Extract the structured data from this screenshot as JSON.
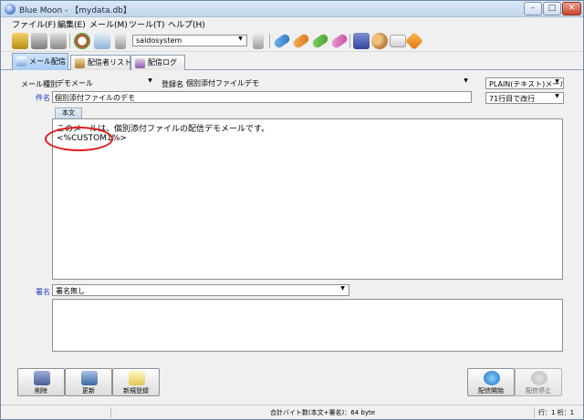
{
  "window": {
    "title": "Blue Moon  - 【mydata.db】",
    "min_label": "–",
    "max_label": "□",
    "close_label": "✕"
  },
  "menu": [
    {
      "label": "ファイル(F)"
    },
    {
      "label": "編集(E)"
    },
    {
      "label": "メール(M)"
    },
    {
      "label": "ツール(T)"
    },
    {
      "label": "ヘルプ(H)"
    }
  ],
  "toolbar": {
    "db_combo": "saldosystem",
    "icons": [
      "db-add-icon",
      "db-open-icon",
      "db-icon",
      "refresh-icon",
      "search-icon",
      "clip-icon",
      "connect-icon",
      "pill-blue-icon",
      "pill-orange-icon",
      "pill-green-icon",
      "pill-pink-icon",
      "book-icon",
      "users-icon",
      "mail-icon",
      "tool-icon"
    ]
  },
  "tabs": [
    {
      "label": "メール配信",
      "active": true
    },
    {
      "label": "配信者リスト",
      "active": false
    },
    {
      "label": "配信ログ",
      "active": false
    }
  ],
  "form": {
    "mail_type_label": "メール種別",
    "mail_type_value": "デモメール",
    "register_label": "登録名",
    "register_value": "個別添付ファイルデモ",
    "format_value": "PLAIN(テキスト)メール",
    "subject_label": "件名",
    "subject_value": "個別添付ファイルのデモ",
    "wrap_value": "71行目で改行",
    "body_tab": "本文",
    "body_lines": [
      "このメールは、個別添付ファイルの配信デモメールです。",
      "<%CUSTOM1%>"
    ],
    "signature_label": "署名",
    "signature_value": "署名無し"
  },
  "buttons": {
    "delete": "削除",
    "update": "更新",
    "new": "新規登録",
    "start": "配信開始",
    "stop": "配信停止"
  },
  "status": {
    "bytes": "合計バイト数(本文+署名)：64 byte",
    "position": "行：1  桁：1"
  }
}
